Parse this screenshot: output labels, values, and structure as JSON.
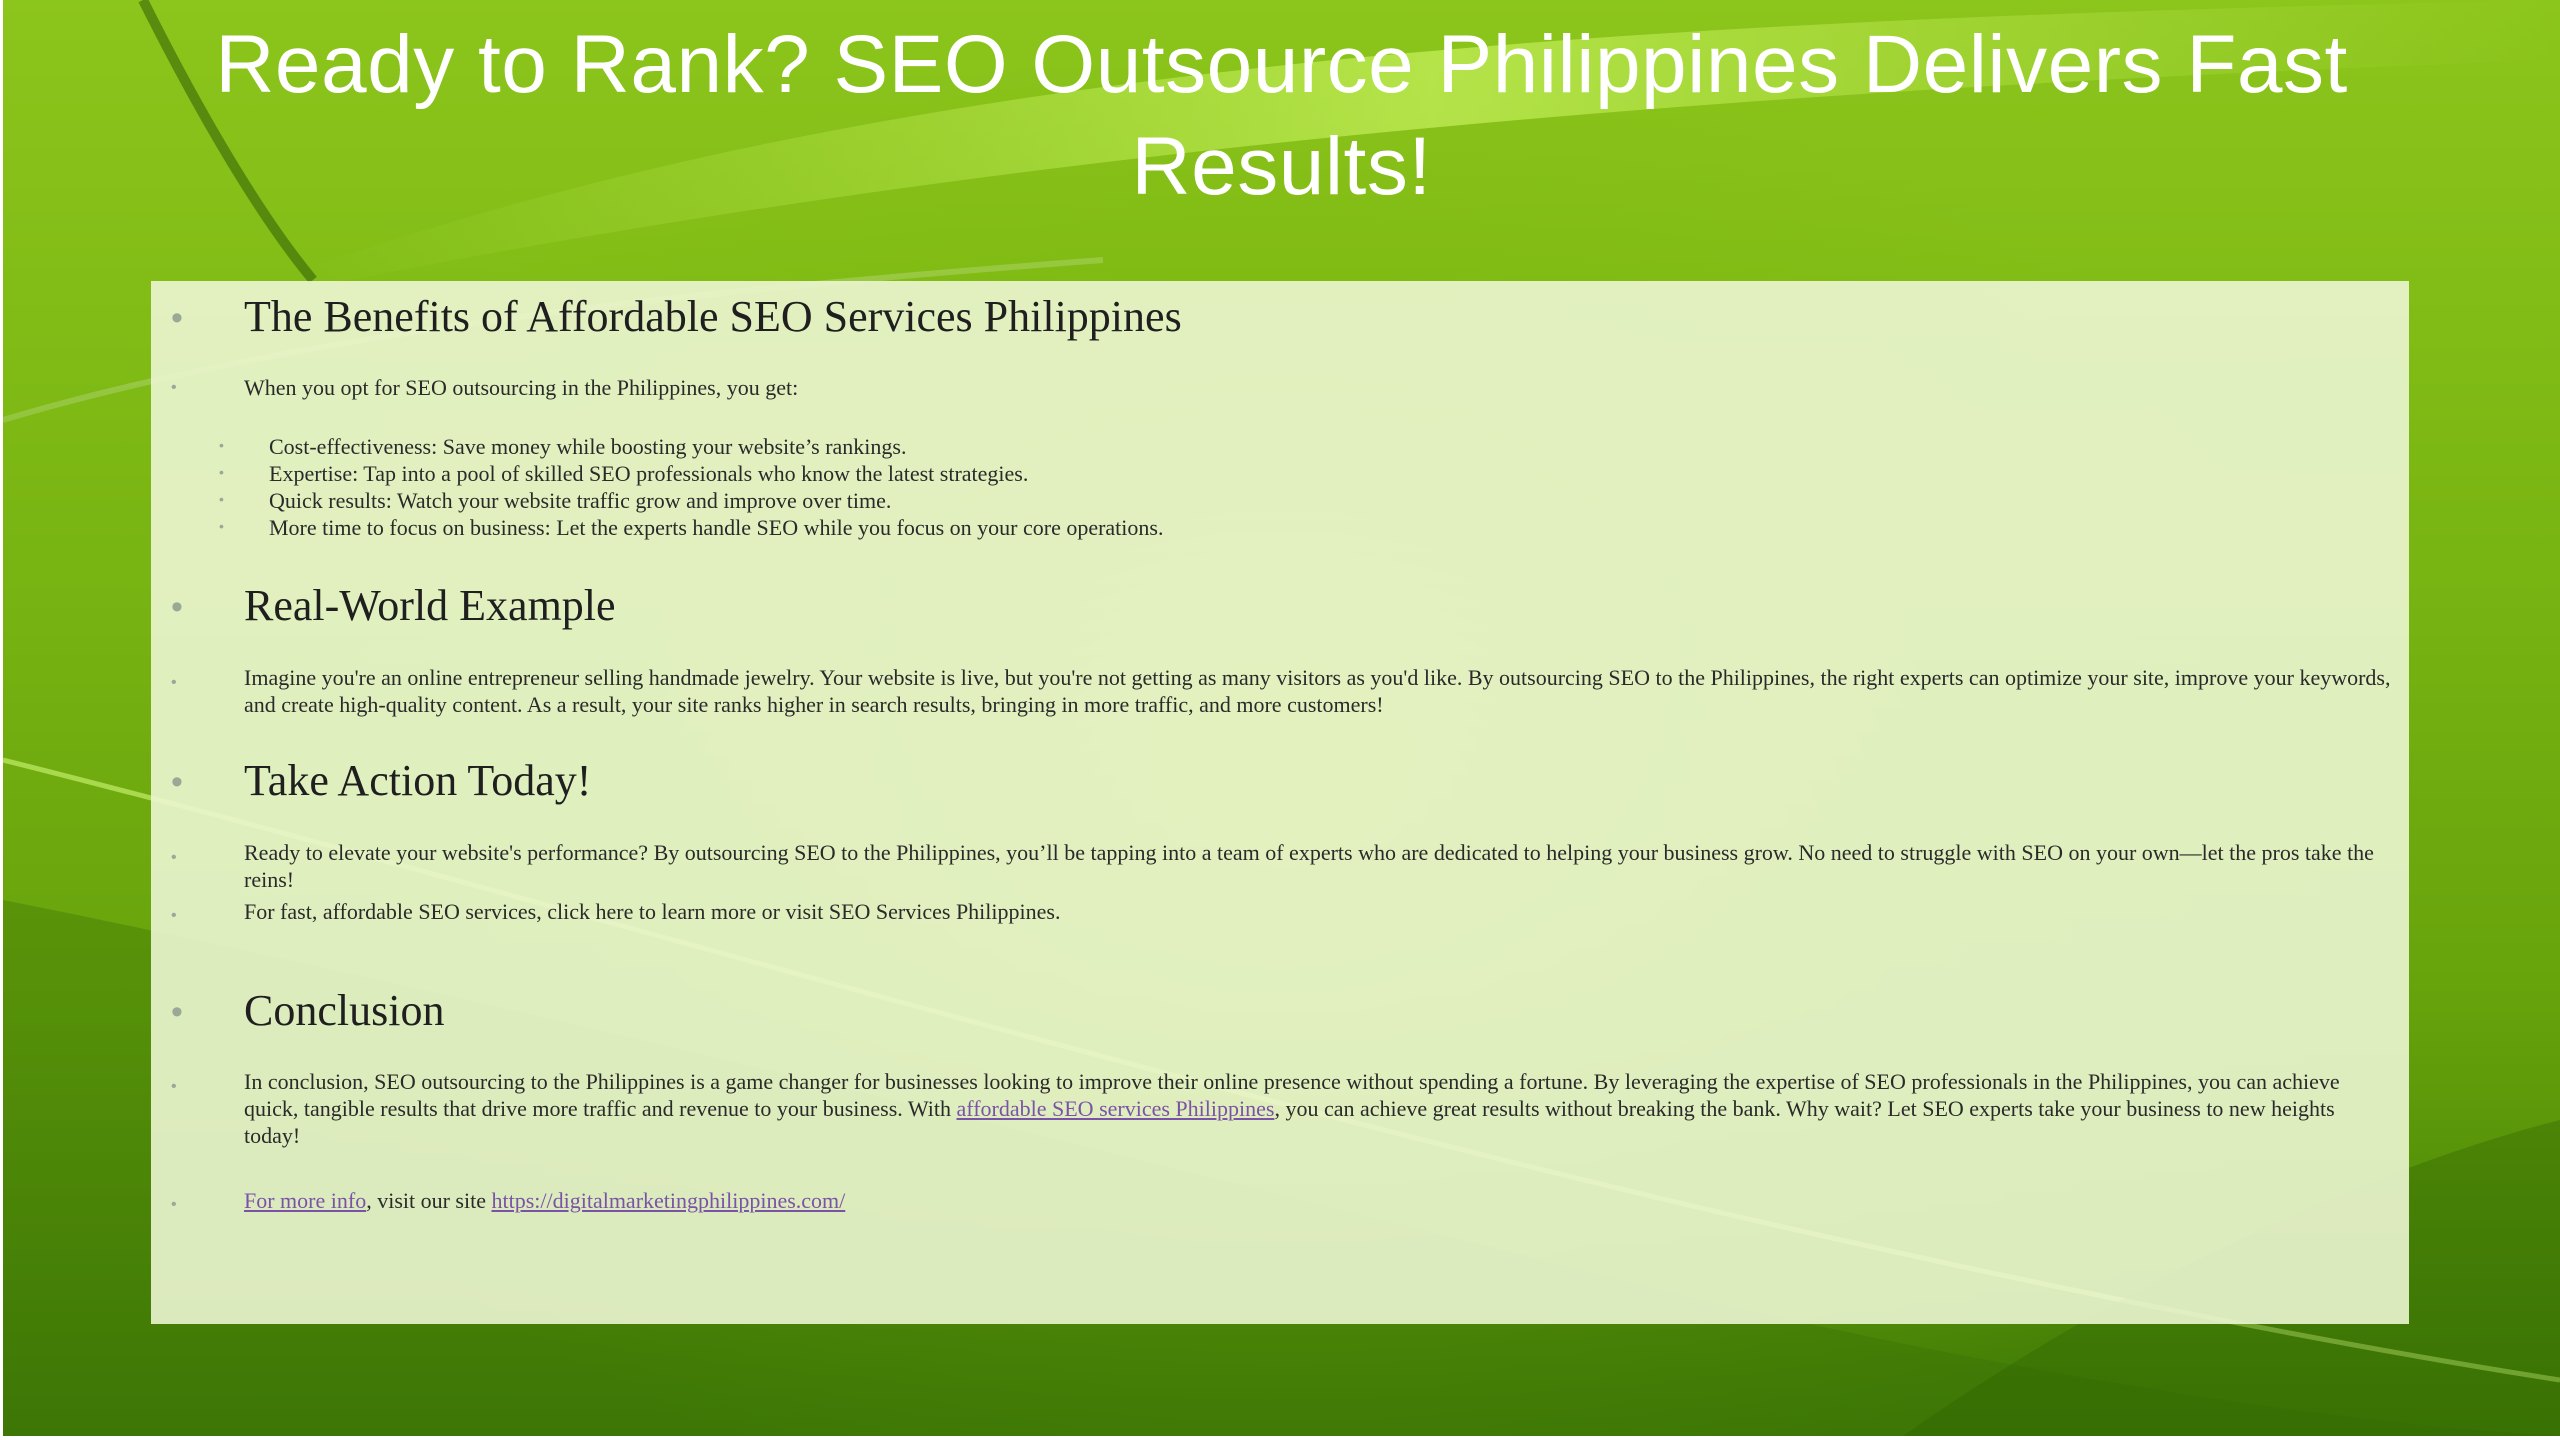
{
  "slide": {
    "title": "Ready to Rank? SEO Outsource Philippines Delivers Fast Results!"
  },
  "sections": {
    "benefits": {
      "heading": "The Benefits of Affordable SEO Services Philippines",
      "intro": "When you opt for SEO outsourcing in the Philippines, you get:",
      "items": [
        "Cost-effectiveness: Save money while boosting your website’s rankings.",
        "Expertise: Tap into a pool of skilled SEO professionals who know the latest strategies.",
        "Quick results: Watch your website traffic grow and improve over time.",
        "More time to focus on business: Let the experts handle SEO while you focus on your core operations."
      ]
    },
    "example": {
      "heading": "Real-World Example",
      "text": "Imagine you're an online entrepreneur selling handmade jewelry. Your website is live, but you're not getting as many visitors as you'd like. By outsourcing SEO to the Philippines, the right experts can optimize your site, improve your keywords, and create high-quality content. As a result, your site ranks higher in search results, bringing in more traffic, and more customers!"
    },
    "action": {
      "heading": "Take Action Today!",
      "text1": "Ready to elevate your website's performance? By outsourcing SEO to the Philippines, you’ll be tapping into a team of experts who are dedicated to helping your business grow. No need to struggle with SEO on your own—let the pros take the reins!",
      "text2": "For fast, affordable SEO services, click here to learn more or visit SEO Services Philippines."
    },
    "conclusion": {
      "heading": "Conclusion",
      "text_before_link": "In conclusion, SEO outsourcing to the Philippines is a game changer for businesses looking to improve their online presence without spending a fortune. By leveraging the expertise of SEO professionals in the Philippines, you can achieve quick, tangible results that drive more traffic and revenue to your business. With ",
      "link_text": "affordable SEO services Philippines",
      "text_after_link": ", you can achieve great results without breaking the bank. Why wait? Let SEO experts take your business to new heights today!",
      "more_info_link": "For more info",
      "more_info_middle": ", visit our site ",
      "site_link": "https://digitalmarketingphilippines.com/"
    }
  },
  "colors": {
    "background_green": "#78b412",
    "panel": "#ecf6d2",
    "link": "#7a52a8",
    "title_text": "#ffffff"
  }
}
